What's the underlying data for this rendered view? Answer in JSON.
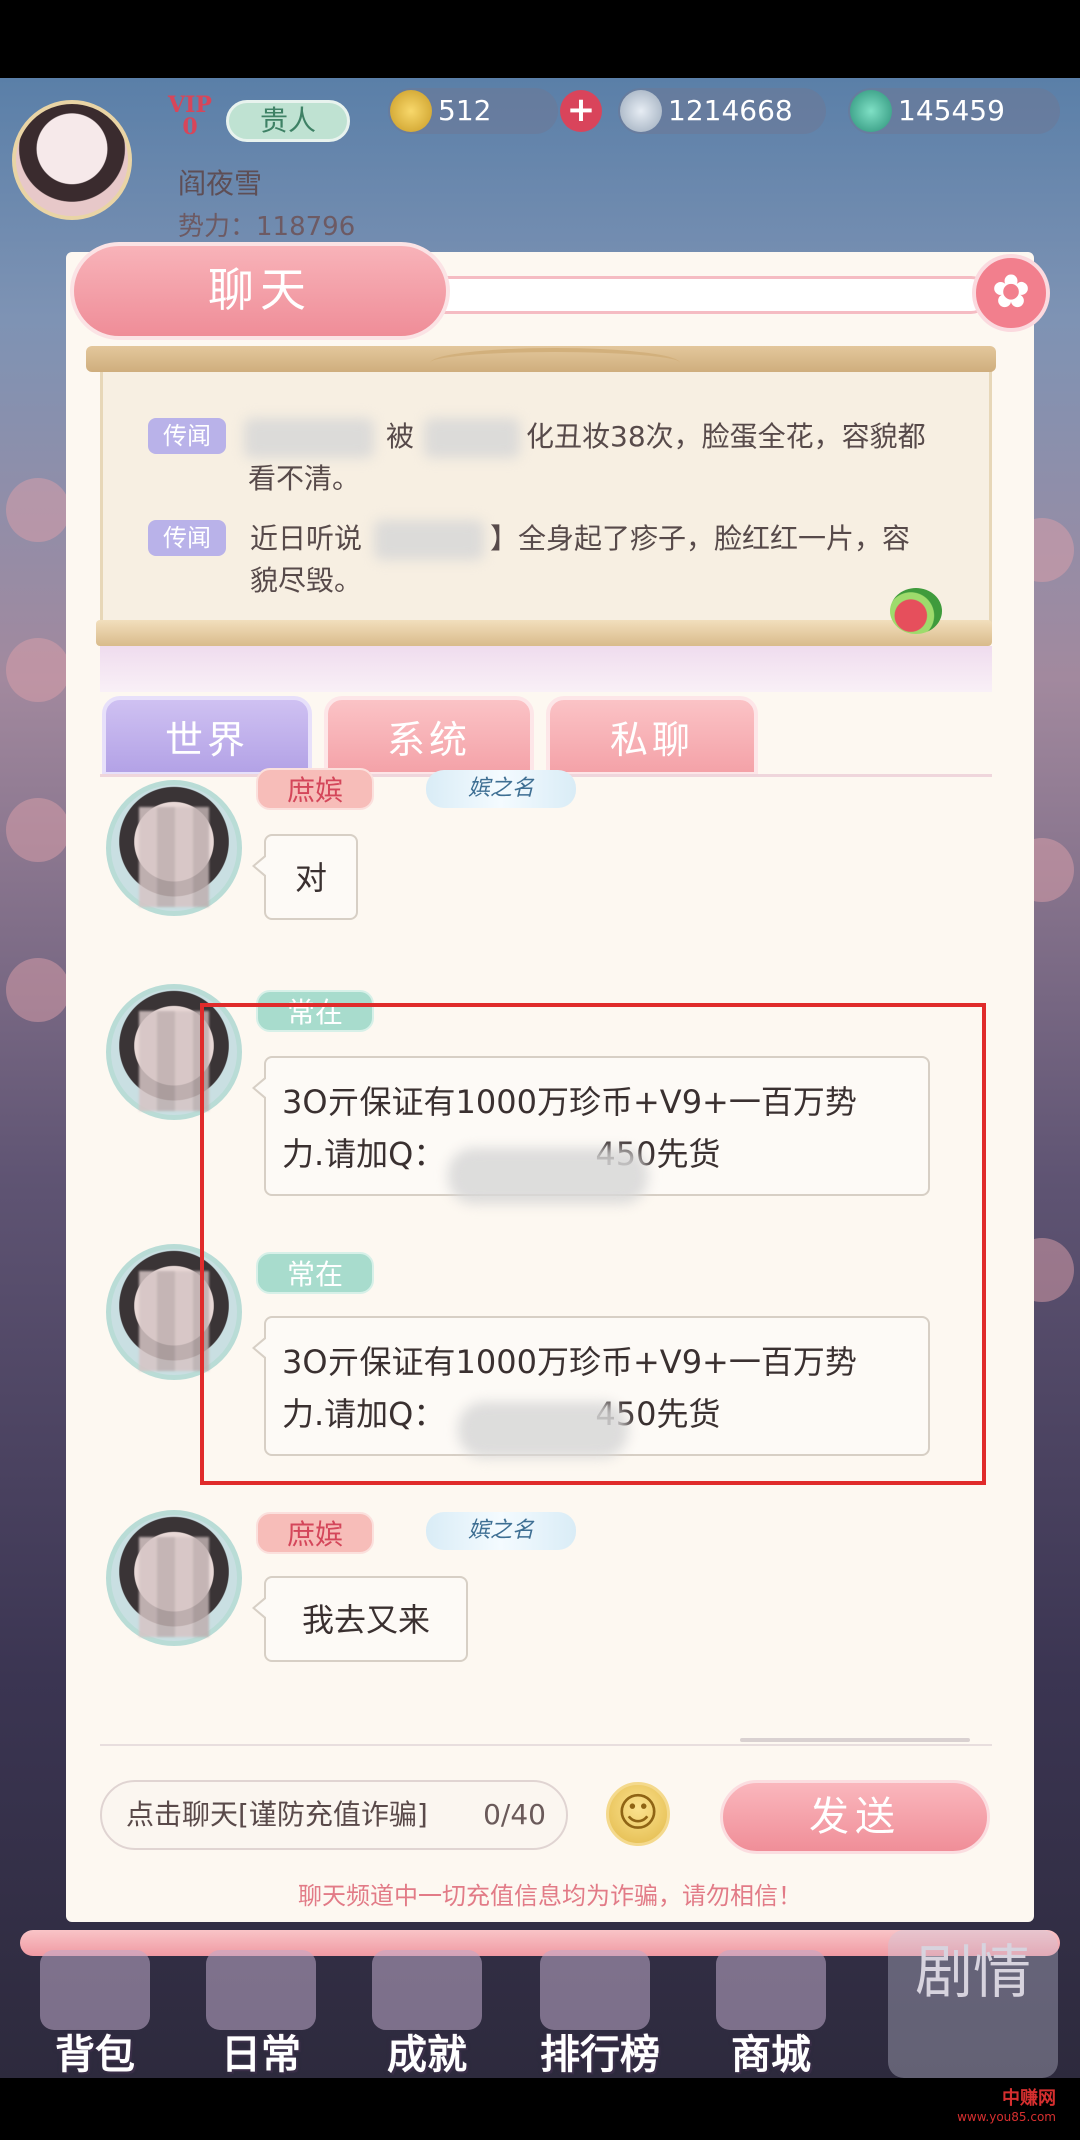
{
  "player": {
    "vip_label": "VIP",
    "vip_level": "0",
    "rank": "贵人",
    "name": "阎夜雪",
    "power": "势力：118796"
  },
  "resources": {
    "gold": "512",
    "coins": "1214668",
    "gems": "145459"
  },
  "chat": {
    "title": "聊天",
    "close_icon": "flower-close-icon"
  },
  "rumors": [
    {
      "tag": "传闻",
      "part1": "被",
      "part2": "化丑妆38次，脸蛋全花，容貌都",
      "line2": "看不清。"
    },
    {
      "tag": "传闻",
      "part1": "近日听说",
      "part2": "】全身起了疹子，脸红红一片，容",
      "line2": "貌尽毁。"
    }
  ],
  "tabs": [
    {
      "label": "世界",
      "active": true
    },
    {
      "label": "系统",
      "active": false
    },
    {
      "label": "私聊",
      "active": false
    }
  ],
  "messages": [
    {
      "rank": "庶嫔",
      "title_badge": "嫔之名",
      "text": "对"
    },
    {
      "rank": "常在",
      "line1": "3O亓保证有1000万珍币+V9+一百万势",
      "line2_prefix": "力.请加Q：",
      "line2_suffix": "450先货"
    },
    {
      "rank": "常在",
      "line1": "3O亓保证有1000万珍币+V9+一百万势",
      "line2_prefix": "力.请加Q：",
      "line2_suffix": "450先货"
    },
    {
      "rank": "庶嫔",
      "title_badge": "嫔之名",
      "text": "我去又来"
    }
  ],
  "input": {
    "placeholder": "点击聊天[谨防充值诈骗]",
    "count": "0/40",
    "send_label": "发送",
    "warning": "聊天频道中一切充值信息均为诈骗，请勿相信！"
  },
  "nav": [
    {
      "label": "背包"
    },
    {
      "label": "日常"
    },
    {
      "label": "成就"
    },
    {
      "label": "排行榜"
    },
    {
      "label": "商城"
    }
  ],
  "plot_label": "剧情",
  "watermark": {
    "line1": "中赚网",
    "line2": "www.you85.com"
  },
  "colors": {
    "accent_pink": "#f08e98",
    "tab_active": "#b3a2e6",
    "rank_green": "#a8dccd",
    "highlight_red": "#e02b2b"
  }
}
